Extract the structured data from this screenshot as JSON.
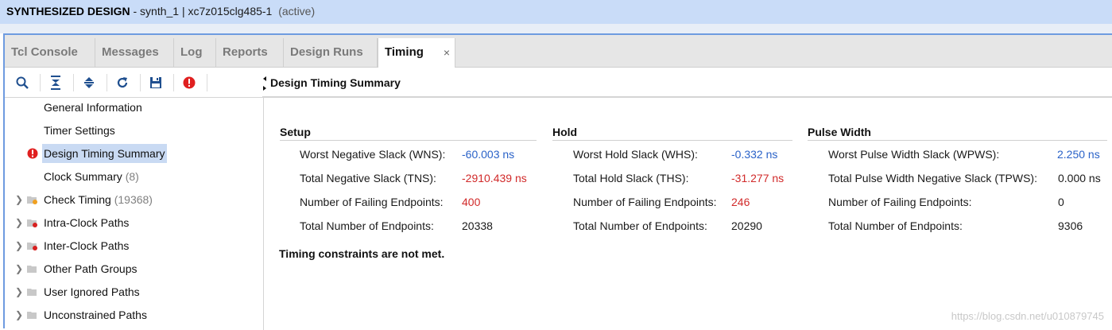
{
  "title": {
    "main": "SYNTHESIZED DESIGN",
    "sub": "- synth_1 | xc7z015clg485-1",
    "state": "(active)"
  },
  "tabs": [
    {
      "label": "Tcl Console"
    },
    {
      "label": "Messages"
    },
    {
      "label": "Log"
    },
    {
      "label": "Reports"
    },
    {
      "label": "Design Runs"
    },
    {
      "label": "Timing",
      "close": "×"
    }
  ],
  "toolbar_icons": [
    "search-icon",
    "collapse-all-icon",
    "expand-all-icon",
    "refresh-icon",
    "save-icon",
    "error-icon"
  ],
  "header": {
    "title": "Design Timing Summary"
  },
  "tree": [
    {
      "label": "General Information"
    },
    {
      "label": "Timer Settings"
    },
    {
      "label": "Design Timing Summary",
      "selected": true
    },
    {
      "label": "Clock Summary",
      "count": "(8)"
    },
    {
      "label": "Check Timing",
      "count": "(19368)"
    },
    {
      "label": "Intra-Clock Paths"
    },
    {
      "label": "Inter-Clock Paths"
    },
    {
      "label": "Other Path Groups"
    },
    {
      "label": "User Ignored Paths"
    },
    {
      "label": "Unconstrained Paths"
    }
  ],
  "setup": {
    "title": "Setup",
    "rows": [
      {
        "k": "Worst Negative Slack (WNS):",
        "v": "-60.003 ns",
        "c": "blue"
      },
      {
        "k": "Total Negative Slack (TNS):",
        "v": "-2910.439 ns",
        "c": "red"
      },
      {
        "k": "Number of Failing Endpoints:",
        "v": "400",
        "c": "red"
      },
      {
        "k": "Total Number of Endpoints:",
        "v": "20338",
        "c": "dark"
      }
    ]
  },
  "hold": {
    "title": "Hold",
    "rows": [
      {
        "k": "Worst Hold Slack (WHS):",
        "v": "-0.332 ns",
        "c": "blue"
      },
      {
        "k": "Total Hold Slack (THS):",
        "v": "-31.277 ns",
        "c": "red"
      },
      {
        "k": "Number of Failing Endpoints:",
        "v": "246",
        "c": "red"
      },
      {
        "k": "Total Number of Endpoints:",
        "v": "20290",
        "c": "dark"
      }
    ]
  },
  "pulse": {
    "title": "Pulse Width",
    "rows": [
      {
        "k": "Worst Pulse Width Slack (WPWS):",
        "v": "2.250 ns",
        "c": "blue"
      },
      {
        "k": "Total Pulse Width Negative Slack (TPWS):",
        "v": "0.000 ns",
        "c": "dark"
      },
      {
        "k": "Number of Failing Endpoints:",
        "v": "0",
        "c": "dark"
      },
      {
        "k": "Total Number of Endpoints:",
        "v": "9306",
        "c": "dark"
      }
    ]
  },
  "status": "Timing constraints are not met.",
  "watermark": "https://blog.csdn.net/u010879745"
}
